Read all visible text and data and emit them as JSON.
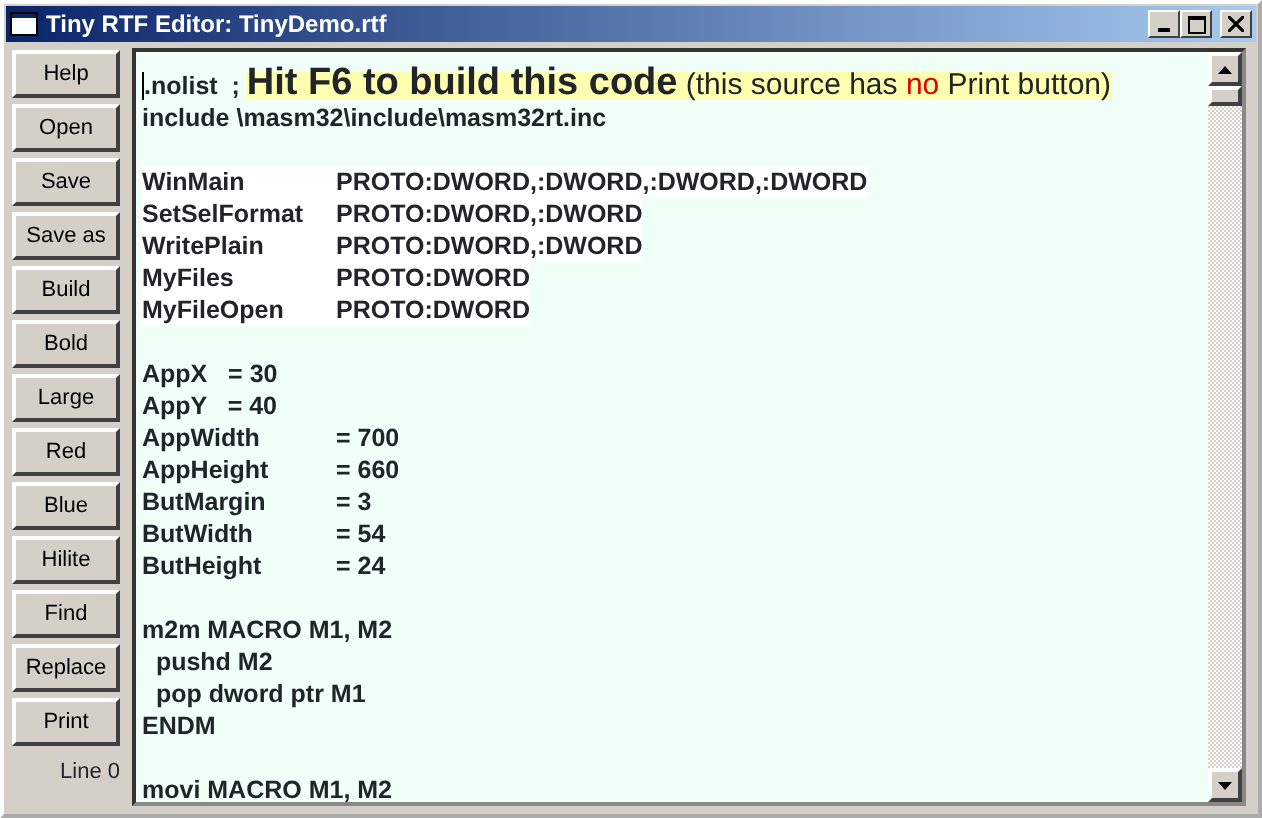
{
  "window": {
    "title": "Tiny RTF Editor: TinyDemo.rtf"
  },
  "buttons": [
    {
      "label": "Help"
    },
    {
      "label": "Open"
    },
    {
      "label": "Save"
    },
    {
      "label": "Save as"
    },
    {
      "label": "Build"
    },
    {
      "label": "Bold"
    },
    {
      "label": "Large"
    },
    {
      "label": "Red"
    },
    {
      "label": "Blue"
    },
    {
      "label": "Hilite"
    },
    {
      "label": "Find"
    },
    {
      "label": "Replace"
    },
    {
      "label": "Print"
    }
  ],
  "status": "Line 0",
  "lines": [
    {
      "kind": "segments",
      "segments": [
        {
          "kind": "plain",
          "text": ".nolist  ; "
        },
        {
          "kind": "large",
          "text": "Hit F6 to build this code"
        },
        {
          "kind": "note",
          "text": " (this source has "
        },
        {
          "kind": "red",
          "text": "no"
        },
        {
          "kind": "note",
          "text": " Print button)"
        }
      ]
    },
    {
      "kind": "text",
      "text": "include \\masm32\\include\\masm32rt.inc"
    },
    {
      "kind": "blank"
    },
    {
      "kind": "tabbed",
      "hilite": true,
      "cells": [
        "WinMain",
        "PROTO:DWORD,:DWORD,:DWORD,:DWORD"
      ]
    },
    {
      "kind": "tabbed",
      "hilite": true,
      "cells": [
        "SetSelFormat",
        "PROTO:DWORD,:DWORD"
      ]
    },
    {
      "kind": "tabbed",
      "hilite": true,
      "cells": [
        "WritePlain",
        "PROTO:DWORD,:DWORD"
      ]
    },
    {
      "kind": "tabbed",
      "hilite": true,
      "cells": [
        "MyFiles",
        "PROTO:DWORD"
      ]
    },
    {
      "kind": "tabbed",
      "hilite": true,
      "cells": [
        "MyFileOpen",
        "PROTO:DWORD"
      ]
    },
    {
      "kind": "blank"
    },
    {
      "kind": "text",
      "text": "AppX   = 30"
    },
    {
      "kind": "text",
      "text": "AppY   = 40"
    },
    {
      "kind": "tabbed",
      "hilite": false,
      "cells": [
        "AppWidth",
        "= 700"
      ]
    },
    {
      "kind": "tabbed",
      "hilite": false,
      "cells": [
        "AppHeight",
        "= 660"
      ]
    },
    {
      "kind": "tabbed",
      "hilite": false,
      "cells": [
        "ButMargin",
        "= 3"
      ]
    },
    {
      "kind": "tabbed",
      "hilite": false,
      "cells": [
        "ButWidth",
        "= 54"
      ]
    },
    {
      "kind": "tabbed",
      "hilite": false,
      "cells": [
        "ButHeight",
        "= 24"
      ]
    },
    {
      "kind": "blank"
    },
    {
      "kind": "text",
      "text": "m2m MACRO M1, M2"
    },
    {
      "kind": "text",
      "text": "  pushd M2"
    },
    {
      "kind": "text",
      "text": "  pop dword ptr M1"
    },
    {
      "kind": "text",
      "text": "ENDM"
    },
    {
      "kind": "blank"
    },
    {
      "kind": "text",
      "text": "movi MACRO M1, M2"
    }
  ]
}
